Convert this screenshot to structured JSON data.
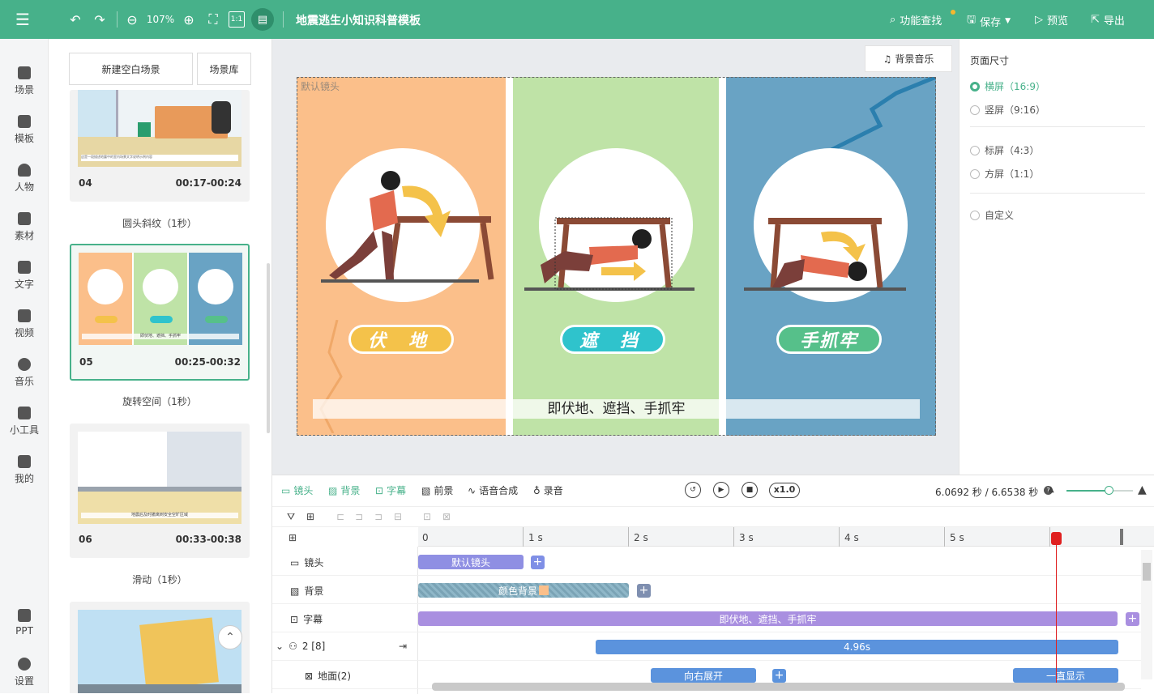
{
  "topbar": {
    "zoom": "107%",
    "title": "地震逃生小知识科普模板",
    "find_label": "功能查找",
    "save_label": "保存",
    "preview_label": "预览",
    "export_label": "导出",
    "accent": "#47b18a"
  },
  "leftnav": [
    {
      "label": "场景"
    },
    {
      "label": "模板"
    },
    {
      "label": "人物"
    },
    {
      "label": "素材"
    },
    {
      "label": "文字"
    },
    {
      "label": "视频"
    },
    {
      "label": "音乐"
    },
    {
      "label": "小工具"
    },
    {
      "label": "我的"
    },
    {
      "label": "PPT"
    },
    {
      "label": "设置"
    }
  ],
  "scenes": {
    "new_blank": "新建空白场景",
    "library": "场景库",
    "items": [
      {
        "num": "04",
        "time": "00:17-00:24",
        "transition": "圆头斜纹（1秒）",
        "caption": "这是一段描述地震中的室内场景文字说明示例内容"
      },
      {
        "num": "05",
        "time": "00:25-00:32",
        "transition": "旋转空间（1秒）",
        "caption": "即伏地、遮挡、手抓牢"
      },
      {
        "num": "06",
        "time": "00:33-00:38",
        "transition": "滑动（1秒）",
        "caption": "地震后及时撤离到安全空旷区域"
      }
    ]
  },
  "canvas": {
    "bgm_label": "背景音乐",
    "default_camera": "默认镜头",
    "panels": [
      {
        "label": "伏 地",
        "bg": "#fbbf8a",
        "pill": "#f4c24a"
      },
      {
        "label": "遮 挡",
        "bg": "#bfe3a7",
        "pill": "#2fc3cc"
      },
      {
        "label": "手抓牢",
        "bg": "#69a3c4",
        "pill": "#56c08a"
      }
    ],
    "subtitle": "即伏地、遮挡、手抓牢"
  },
  "props": {
    "title": "页面尺寸",
    "options": [
      {
        "label": "横屏（16:9）",
        "selected": true
      },
      {
        "label": "竖屏（9:16）",
        "selected": false
      },
      {
        "label": "标屏（4:3）",
        "selected": false
      },
      {
        "label": "方屏（1:1）",
        "selected": false
      },
      {
        "label": "自定义",
        "selected": false
      }
    ]
  },
  "timeline": {
    "tools": [
      "镜头",
      "背景",
      "字幕",
      "前景",
      "语音合成",
      "录音"
    ],
    "speed": "x1.0",
    "time_display": "6.0692 秒 / 6.6538 秒",
    "ticks": [
      "0",
      "1 s",
      "2 s",
      "3 s",
      "4 s",
      "5 s"
    ],
    "rows": [
      {
        "label": "镜头",
        "clip": "默认镜头"
      },
      {
        "label": "背景",
        "clip": "颜色背景"
      },
      {
        "label": "字幕",
        "clip": "即伏地、遮挡、手抓牢"
      },
      {
        "label": "2 [8]",
        "clip": "4.96s"
      },
      {
        "label": "地面(2)",
        "clip": "向右展开",
        "clip2": "一直显示"
      }
    ]
  }
}
